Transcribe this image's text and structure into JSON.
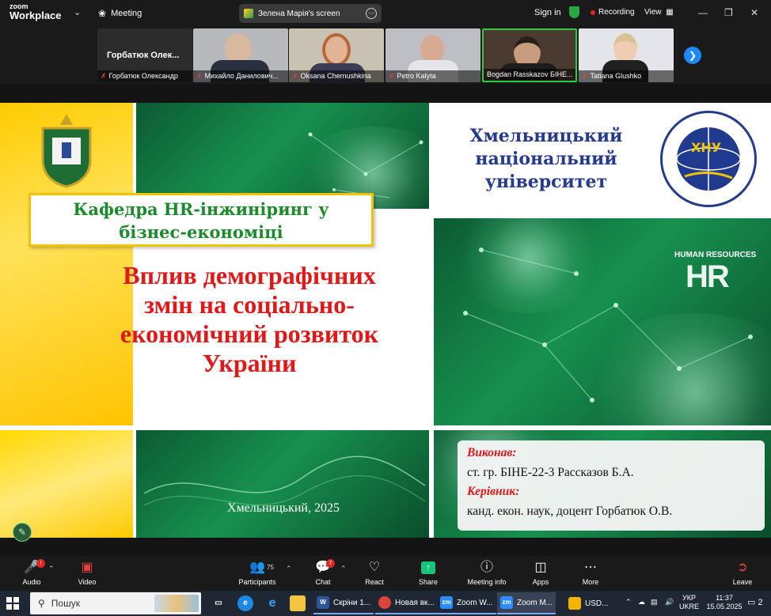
{
  "topbar": {
    "app_small": "zoom",
    "app_name": "Workplace",
    "meeting_label": "Meeting",
    "screen_share_label": "Зелена Марія's screen",
    "sign_in": "Sign in",
    "recording": "Recording",
    "view": "View"
  },
  "participants_strip": [
    {
      "name": "Горбатюк Олександр",
      "display": "Горбатюк Олек..."
    },
    {
      "name": "Михайло Данилович..."
    },
    {
      "name": "Oksana Chernushkina"
    },
    {
      "name": "Petro Kalyta"
    },
    {
      "name": "Bogdan Rasskazov БІНЕ..."
    },
    {
      "name": "Tatiana Glushko"
    }
  ],
  "slide": {
    "kafedra_line1": "Кафедра HR-інжиніринг у",
    "kafedra_line2": "бізнес-економіці",
    "title_line1": "Вплив демографічних",
    "title_line2": "змін на соціально-",
    "title_line3": "економічний розвиток",
    "title_line4": "України",
    "univ_line1": "Хмельницький",
    "univ_line2": "національний",
    "univ_line3": "університет",
    "emblem_abbrev": "ХНУ",
    "emblem_ring": "ХМЕЛЬНИЦЬКИЙ НАЦІОНАЛЬНИЙ УНІВЕРСИТЕТ",
    "hr_small": "HUMAN RESOURCES",
    "hr_big": "HR",
    "city_year": "Хмельницький, 2025",
    "performer_label": "Виконав:",
    "performer": "ст. гр. БІНЕ-22-3 Рассказов Б.А.",
    "supervisor_label": "Керівник:",
    "supervisor": "канд. екон. наук, доцент Горбатюк О.В."
  },
  "toolbar": {
    "audio": "Audio",
    "video": "Video",
    "participants": "Participants",
    "participants_count": "75",
    "chat": "Chat",
    "chat_badge": "7",
    "react": "React",
    "share": "Share",
    "meeting_info": "Meeting info",
    "apps": "Apps",
    "more": "More",
    "leave": "Leave"
  },
  "taskbar": {
    "search": "Пошук",
    "apps": [
      {
        "label": "Скріни 1..."
      },
      {
        "label": "Новая вк..."
      },
      {
        "label": "Zoom W..."
      },
      {
        "label": "Zoom M..."
      },
      {
        "label": "USD..."
      }
    ],
    "lang1": "УКР",
    "lang2": "UKRE",
    "time": "11:37",
    "date": "15.05.2025",
    "notif_count": "2"
  },
  "colors": {
    "accent_green": "#1e8a2e",
    "title_red": "#e01818",
    "univ_blue": "#243a8c",
    "zoom_share_green": "#19c37d",
    "yellow": "#ffd21a"
  }
}
